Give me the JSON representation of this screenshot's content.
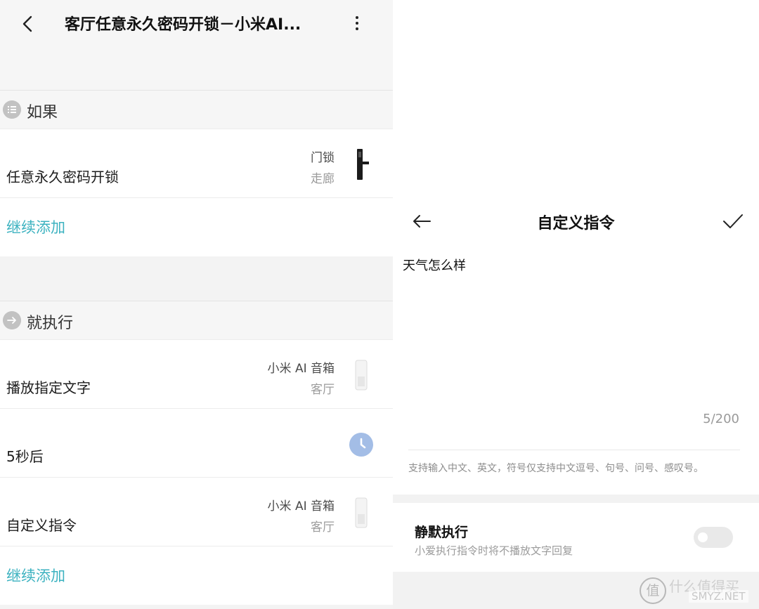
{
  "left": {
    "header": {
      "title": "客厅任意永久密码开锁－小米AI..."
    },
    "if_section": {
      "label": "如果"
    },
    "if_rows": [
      {
        "main": "任意永久密码开锁",
        "device": "门锁",
        "room": "走廊"
      }
    ],
    "add_label_1": "继续添加",
    "then_section": {
      "label": "就执行"
    },
    "then_rows": [
      {
        "main": "播放指定文字",
        "device": "小米 AI 音箱",
        "room": "客厅"
      },
      {
        "main": "5秒后",
        "device": "",
        "room": ""
      },
      {
        "main": "自定义指令",
        "device": "小米 AI 音箱",
        "room": "客厅"
      }
    ],
    "add_label_2": "继续添加"
  },
  "right": {
    "header": {
      "title": "自定义指令"
    },
    "input_value": "天气怎么样",
    "char_count": "5/200",
    "hint": "支持输入中文、英文，符号仅支持中文逗号、句号、问号、感叹号。",
    "silent": {
      "title": "静默执行",
      "subtitle": "小爱执行指令时将不播放文字回复",
      "enabled": false
    }
  },
  "watermark": {
    "logo": "值",
    "text": "什么值得买",
    "url": "SMYZ.NET"
  },
  "colors": {
    "accent": "#3cb2c0",
    "timer_icon": "#a3bde6"
  }
}
